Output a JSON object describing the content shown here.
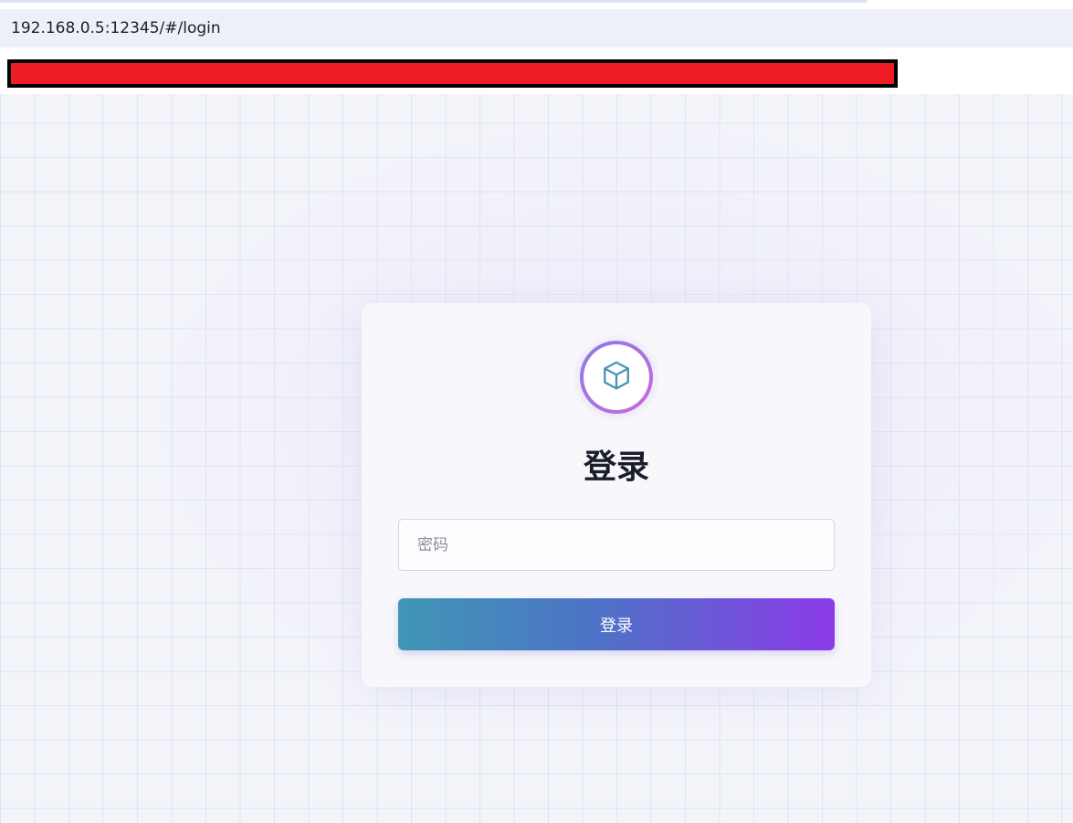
{
  "browser": {
    "url": "192.168.0.5:12345/#/login"
  },
  "login": {
    "logo_icon": "cube-icon",
    "title": "登录",
    "password_placeholder": "密码",
    "password_value": "",
    "submit_label": "登录"
  },
  "colors": {
    "redaction": "#ed1c24",
    "button_gradient_start": "#3f96b5",
    "button_gradient_end": "#8b3ae8",
    "logo_icon_color": "#4a96b8"
  }
}
